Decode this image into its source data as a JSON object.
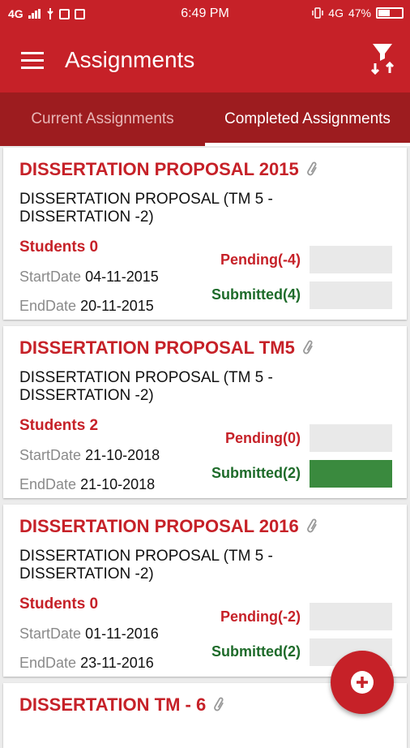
{
  "status": {
    "carrier": "4G",
    "time": "6:49 PM",
    "network": "4G",
    "battery": "47%"
  },
  "appbar": {
    "title": "Assignments"
  },
  "tabs": [
    {
      "label": "Current Assignments"
    },
    {
      "label": "Completed Assignments"
    }
  ],
  "labels": {
    "start": "StartDate",
    "end": "EndDate"
  },
  "assignments": [
    {
      "title": "DISSERTATION PROPOSAL 2015",
      "desc": "DISSERTATION PROPOSAL (TM  5 - DISSERTATION -2)",
      "students": "Students 0",
      "start": "04-11-2015",
      "end": "20-11-2015",
      "pending": "Pending(-4)",
      "submitted": "Submitted(4)",
      "submitted_progress": 0
    },
    {
      "title": "DISSERTATION PROPOSAL TM5",
      "desc": "DISSERTATION PROPOSAL (TM  5 - DISSERTATION -2)",
      "students": "Students 2",
      "start": "21-10-2018",
      "end": "21-10-2018",
      "pending": "Pending(0)",
      "submitted": "Submitted(2)",
      "submitted_progress": 1
    },
    {
      "title": "DISSERTATION PROPOSAL 2016",
      "desc": "DISSERTATION PROPOSAL (TM  5 - DISSERTATION -2)",
      "students": "Students 0",
      "start": "01-11-2016",
      "end": "23-11-2016",
      "pending": "Pending(-2)",
      "submitted": "Submitted(2)",
      "submitted_progress": 0
    },
    {
      "title": "DISSERTATION TM - 6"
    }
  ]
}
